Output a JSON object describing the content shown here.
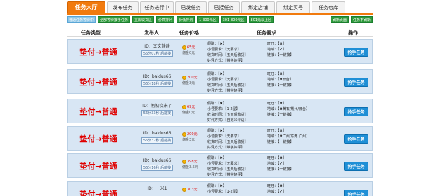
{
  "nav": {
    "tabs": [
      "任务大厅",
      "发布任务",
      "任务进行中",
      "已发任务",
      "已接任务",
      "绑定店铺",
      "绑定买号",
      "任务仓库"
    ]
  },
  "filters": {
    "items": [
      "普通任务等待中",
      "全部等待接手任务",
      "立即收货区",
      "价高排列",
      "价低排列",
      "1-300元区",
      "301-800元区",
      "801元以上区"
    ],
    "right": [
      "刷新页面",
      "任务不刷新"
    ]
  },
  "table": {
    "headers": [
      "任务类型",
      "发布人",
      "任务价格",
      "任务要求",
      "操作"
    ]
  },
  "rows": [
    {
      "type": "垫付→普通",
      "id": "ID：文文静静",
      "time": "56分07秒 后能接",
      "price": "65元",
      "bonus": "佣金0元",
      "l1": "假聊：【✖】",
      "l2": "小号要求：【无要求】",
      "l3": "收货时间：【五天后收货】",
      "l4": "好评方式：【带字好评】",
      "r1": "旺旺：【✖】",
      "r2": "地域：【✔】",
      "r3": "链接：【一链接】",
      "action": "抢手任务"
    },
    {
      "type": "垫付→普通",
      "id": "ID：baidus66",
      "time": "56分18秒 后能接",
      "price": "200元",
      "bonus": "佣金3元",
      "l1": "假聊：【✖】",
      "l2": "小号要求：【无要求】",
      "l3": "收货时间：【五天后收货】",
      "l4": "好评方式：【带字好评】",
      "r1": "旺旺：【✖】",
      "r2": "地域：【✖邢台】",
      "r3": "链接：【一链接】",
      "action": "抢手任务"
    },
    {
      "type": "垫付→普通",
      "id": "ID：初初次来了",
      "time": "56分33秒 后能接",
      "price": "69元",
      "bonus": "佣金0元",
      "l1": "假聊：【✖】",
      "l2": "小号要求：【1-2星】",
      "l3": "收货时间：【五天后收货】",
      "l4": "好评方式：【自定义评语】",
      "r1": "旺旺：【✖】",
      "r2": "地域：【✖黄石/荆州/邢台】",
      "r3": "链接：【一链接】",
      "action": "抢手任务"
    },
    {
      "type": "垫付→普通",
      "id": "ID：baidus66",
      "time": "56分32秒 后能接",
      "price": "200元",
      "bonus": "佣金3元",
      "l1": "假聊：【✖】",
      "l2": "小号要求：【无要求】",
      "l3": "收货时间：【五天后收货】",
      "l4": "好评方式：【带字好评】",
      "r1": "旺旺：【✖】",
      "r2": "地域：【✖广州/东莞 广州】",
      "r3": "链接：【一链接】",
      "action": "抢手任务"
    },
    {
      "type": "垫付→普通",
      "id": "ID：baidus66",
      "time": "56分16秒 后能接",
      "price": "398元",
      "bonus": "佣金3.5元",
      "l1": "假聊：【✖】",
      "l2": "小号要求：【无要求】",
      "l3": "收货时间：【五天后收货】",
      "l4": "好评方式：【带字好评】",
      "r1": "旺旺：【✖】",
      "r2": "地域：【✔】",
      "r3": "链接：【一链接】",
      "action": "抢手任务"
    },
    {
      "type": "垫付→普通",
      "id": "ID：一米1",
      "time": "",
      "price": "303元",
      "bonus": "",
      "l1": "假聊：【✖】",
      "l2": "小号要求：【1-2星】",
      "l3": "",
      "l4": "",
      "r1": "旺旺：【✖】",
      "r2": "地域：【✔】",
      "r3": "",
      "action": "抢手任务"
    }
  ]
}
